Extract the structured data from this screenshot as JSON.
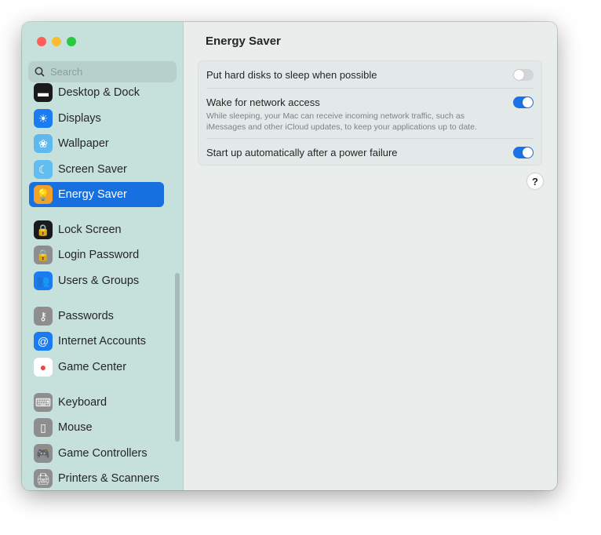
{
  "search": {
    "placeholder": "Search"
  },
  "sidebar": {
    "items": [
      {
        "label": "Desktop & Dock",
        "icon": "desktop-dock-icon",
        "color": "#1a1a1a",
        "glyph": "▬"
      },
      {
        "label": "Displays",
        "icon": "displays-icon",
        "color": "#1a7cf0",
        "glyph": "☀"
      },
      {
        "label": "Wallpaper",
        "icon": "wallpaper-icon",
        "color": "#5fb9ee",
        "glyph": "❀"
      },
      {
        "label": "Screen Saver",
        "icon": "screen-saver-icon",
        "color": "#62bdf0",
        "glyph": "☾"
      },
      {
        "label": "Energy Saver",
        "icon": "energy-saver-icon",
        "color": "#f4a12a",
        "glyph": "💡"
      },
      {
        "label": "Lock Screen",
        "icon": "lock-screen-icon",
        "color": "#1a1a1a",
        "glyph": "🔒"
      },
      {
        "label": "Login Password",
        "icon": "login-password-icon",
        "color": "#8e8e8e",
        "glyph": "🔒"
      },
      {
        "label": "Users & Groups",
        "icon": "users-groups-icon",
        "color": "#1a7cf0",
        "glyph": "👥"
      },
      {
        "label": "Passwords",
        "icon": "passwords-icon",
        "color": "#8e8e8e",
        "glyph": "⚷"
      },
      {
        "label": "Internet Accounts",
        "icon": "internet-accounts-icon",
        "color": "#1a7cf0",
        "glyph": "@"
      },
      {
        "label": "Game Center",
        "icon": "game-center-icon",
        "color": "#ffffff",
        "glyph": "●"
      },
      {
        "label": "Keyboard",
        "icon": "keyboard-icon",
        "color": "#8e8e8e",
        "glyph": "⌨"
      },
      {
        "label": "Mouse",
        "icon": "mouse-icon",
        "color": "#8e8e8e",
        "glyph": "▯"
      },
      {
        "label": "Game Controllers",
        "icon": "game-controllers-icon",
        "color": "#8e8e8e",
        "glyph": "🎮"
      },
      {
        "label": "Printers & Scanners",
        "icon": "printers-scanners-icon",
        "color": "#8e8e8e",
        "glyph": "🖨"
      }
    ],
    "selected": 4
  },
  "main": {
    "title": "Energy Saver",
    "settings": [
      {
        "label": "Put hard disks to sleep when possible",
        "on": false
      },
      {
        "label": "Wake for network access",
        "description": "While sleeping, your Mac can receive incoming network traffic, such as iMessages and other iCloud updates, to keep your applications up to date.",
        "on": true
      },
      {
        "label": "Start up automatically after a power failure",
        "on": true
      }
    ],
    "help": "?"
  }
}
